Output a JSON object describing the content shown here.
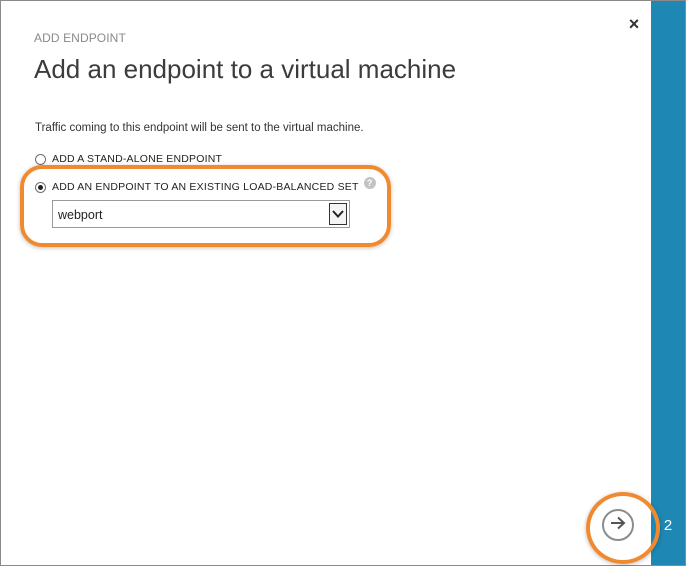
{
  "dialog": {
    "subtitle": "ADD ENDPOINT",
    "title": "Add an endpoint to a virtual machine",
    "description": "Traffic coming to this endpoint will be sent to the virtual machine.",
    "close_icon": "close-icon",
    "step_number": "2"
  },
  "options": [
    {
      "label": "ADD A STAND-ALONE ENDPOINT",
      "selected": false
    },
    {
      "label": "ADD AN ENDPOINT TO AN EXISTING LOAD-BALANCED SET",
      "selected": true
    }
  ],
  "help_icon_text": "?",
  "load_balanced_set": {
    "selected_value": "webport"
  },
  "next_button": {
    "icon": "arrow-right-icon"
  },
  "colors": {
    "accent_strip": "#1e87b4",
    "highlight": "#f08a30"
  }
}
